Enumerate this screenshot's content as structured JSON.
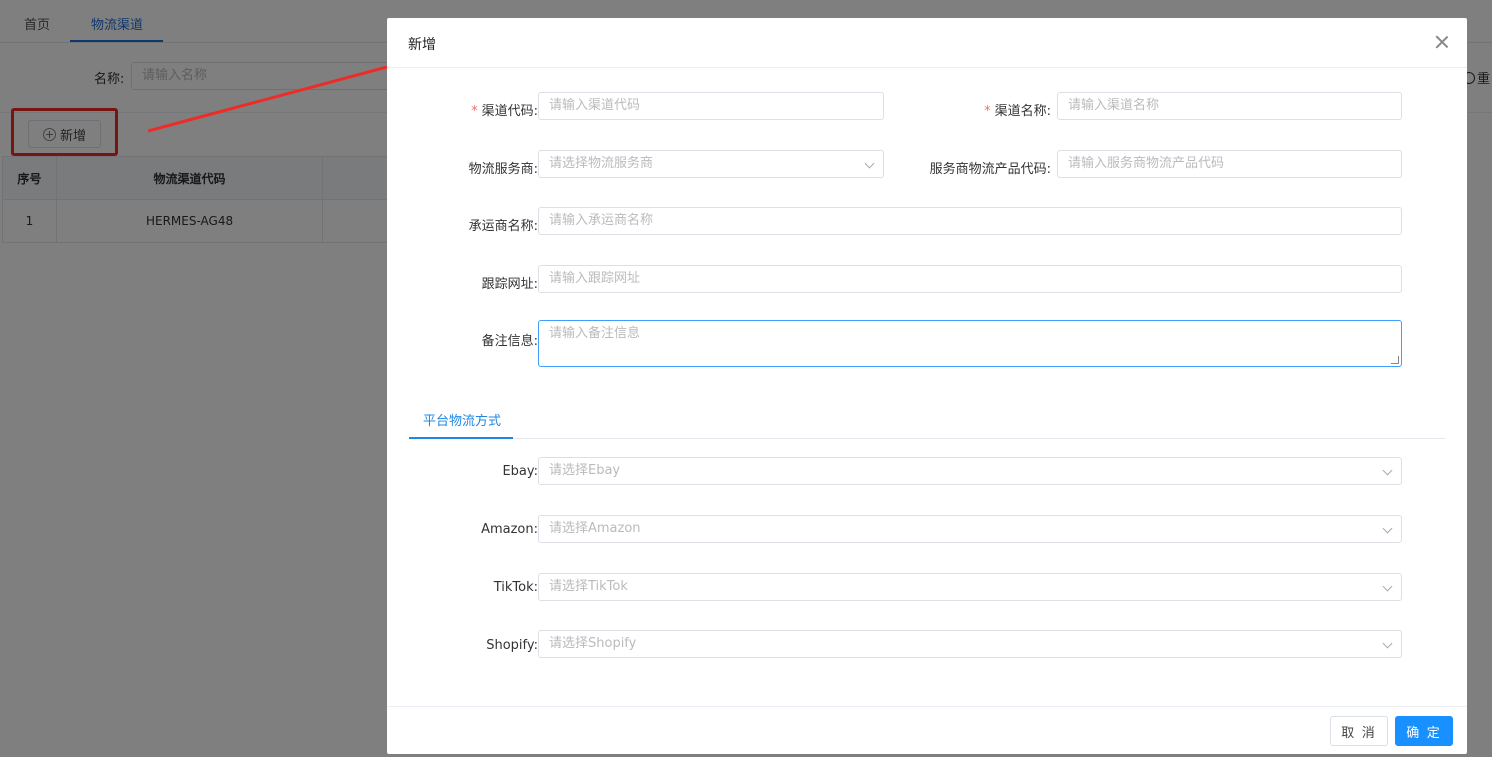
{
  "background": {
    "tabs": [
      {
        "label": "首页"
      },
      {
        "label": "物流渠道"
      }
    ],
    "search": {
      "label": "名称:",
      "placeholder": "请输入名称"
    },
    "add_button_label": "新增",
    "right_fragment": "重",
    "table": {
      "columns": [
        "序号",
        "物流渠道代码"
      ],
      "rows": [
        {
          "index": "1",
          "code": "HERMES-AG48"
        }
      ]
    }
  },
  "modal": {
    "title": "新增",
    "fields": {
      "channel_code": {
        "label": "渠道代码:",
        "placeholder": "请输入渠道代码",
        "required": true
      },
      "channel_name": {
        "label": "渠道名称:",
        "placeholder": "请输入渠道名称",
        "required": true
      },
      "provider": {
        "label": "物流服务商:",
        "placeholder": "请选择物流服务商"
      },
      "provider_product_code": {
        "label": "服务商物流产品代码:",
        "placeholder": "请输入服务商物流产品代码"
      },
      "carrier_name": {
        "label": "承运商名称:",
        "placeholder": "请输入承运商名称"
      },
      "tracking_url": {
        "label": "跟踪网址:",
        "placeholder": "请输入跟踪网址"
      },
      "remarks": {
        "label": "备注信息:",
        "placeholder": "请输入备注信息"
      }
    },
    "platform_tab": "平台物流方式",
    "platforms": {
      "ebay": {
        "label": "Ebay:",
        "placeholder": "请选择Ebay"
      },
      "amazon": {
        "label": "Amazon:",
        "placeholder": "请选择Amazon"
      },
      "tiktok": {
        "label": "TikTok:",
        "placeholder": "请选择TikTok"
      },
      "shopify": {
        "label": "Shopify:",
        "placeholder": "请选择Shopify"
      }
    },
    "footer": {
      "cancel_label": "取 消",
      "confirm_label": "确 定"
    }
  },
  "colors": {
    "primary": "#1890ff",
    "tab_active": "#1e6fd9",
    "required": "#f56c6c",
    "annotation_red": "#ee2b26"
  }
}
